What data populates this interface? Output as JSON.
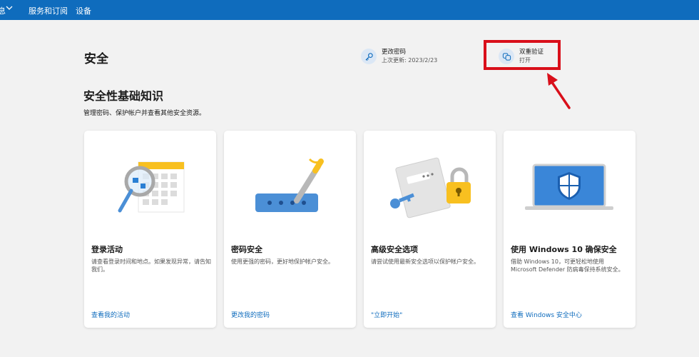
{
  "topbar": {
    "partial_item": "息",
    "services_label": "服务和订阅",
    "devices_label": "设备"
  },
  "page": {
    "title": "安全"
  },
  "quick_actions": {
    "password": {
      "title": "更改密码",
      "subtitle": "上次更新: 2023/2/23",
      "icon": "key-icon"
    },
    "two_step": {
      "title": "双重验证",
      "subtitle": "打开",
      "icon": "two-step-icon"
    }
  },
  "highlight_color": "#d90f1a",
  "section": {
    "title": "安全性基础知识",
    "description": "管理密码、保护帐户并查看其他安全资源。"
  },
  "cards": [
    {
      "title": "登录活动",
      "description": "请查看登录时间和地点。如果发现异常，请告知我们。",
      "link": "查看我的活动",
      "icon": "calendar-magnifier-icon"
    },
    {
      "title": "密码安全",
      "description": "使用更强的密码，更好地保护帐户安全。",
      "link": "更改我的密码",
      "icon": "password-field-pen-icon"
    },
    {
      "title": "高级安全选项",
      "description": "请尝试使用最新安全选项以保护帐户安全。",
      "link": "\"立即开始\"",
      "icon": "lock-key-icon"
    },
    {
      "title": "使用 Windows 10 确保安全",
      "description": "借助 Windows 10，可更轻松地使用 Microsoft Defender 防病毒保持系统安全。",
      "link": "查看 Windows 安全中心",
      "icon": "laptop-shield-icon"
    }
  ],
  "colors": {
    "accent": "#0f6cbd",
    "background": "#f2f2f2"
  }
}
